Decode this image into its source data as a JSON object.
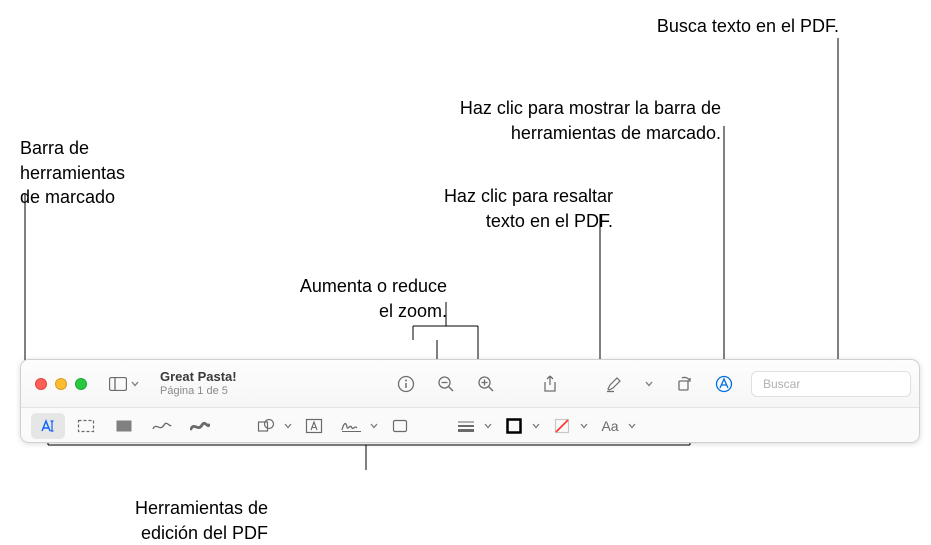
{
  "callouts": {
    "search_hint": "Busca texto en el PDF.",
    "markup_toolbar_label": "Barra de\nherramientas\nde marcado",
    "show_markup_hint": "Haz clic para mostrar la barra de\nherramientas de marcado.",
    "highlight_hint": "Haz clic para resaltar\ntexto en el PDF.",
    "zoom_hint": "Aumenta o reduce\nel zoom.",
    "editing_tools_label": "Herramientas de\nedición del PDF"
  },
  "window": {
    "title": "Great Pasta!",
    "subtitle": "Página 1 de 5"
  },
  "search": {
    "placeholder": "Buscar",
    "value": ""
  }
}
